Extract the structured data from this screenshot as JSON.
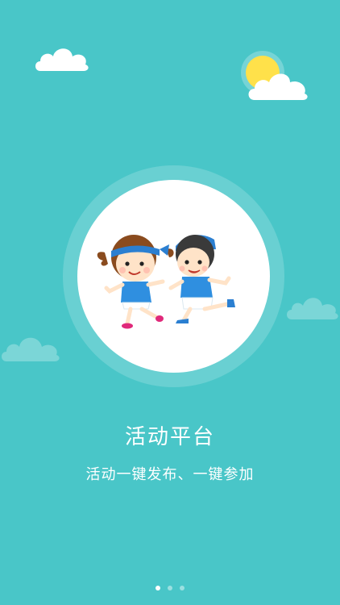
{
  "onboarding": {
    "title": "活动平台",
    "subtitle": "活动一键发布、一键参加",
    "current_page": 1,
    "total_pages": 3
  },
  "colors": {
    "background": "#49c6c8",
    "sun": "#ffe14a",
    "headband": "#2b7fd1",
    "shirt": "#2f8fe0"
  }
}
